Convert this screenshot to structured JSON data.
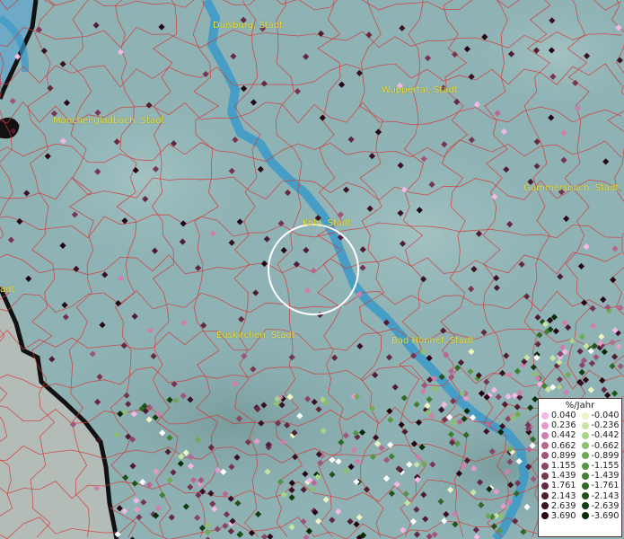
{
  "cities": [
    {
      "id": "duisburg",
      "label": "Duisburg, Stadt"
    },
    {
      "id": "wuppertal",
      "label": "Wuppertal, Stadt"
    },
    {
      "id": "moenchengladbach",
      "label": "Mönchengladbach, Stadt"
    },
    {
      "id": "gummersbach",
      "label": "Gummersbach, Stadt"
    },
    {
      "id": "koeln",
      "label": "Köln, Stadt"
    },
    {
      "id": "euskirchen",
      "label": "Euskirchen, Stadt"
    },
    {
      "id": "bad_honnef",
      "label": "Bad Honnef, Stadt"
    },
    {
      "id": "left_edge",
      "label": "adt"
    }
  ],
  "legend": {
    "title": "%/Jahr",
    "positive": [
      "0.040",
      "0.236",
      "0.442",
      "0.662",
      "0.899",
      "1.155",
      "1.439",
      "1.761",
      "2.143",
      "2.639",
      "3.690"
    ],
    "negative": [
      "-0.040",
      "-0.236",
      "-0.442",
      "-0.662",
      "-0.899",
      "-1.155",
      "-1.439",
      "-1.761",
      "-2.143",
      "-2.639",
      "-3.690"
    ],
    "positive_colors": [
      "#f5b8e6",
      "#e59acc",
      "#cf7fad",
      "#b86890",
      "#a0557a",
      "#8a4465",
      "#763652",
      "#632941",
      "#4f1d31",
      "#3b1222",
      "#260612"
    ],
    "negative_colors": [
      "#eef4c4",
      "#c8e3a4",
      "#a8d488",
      "#8cc06e",
      "#70aa58",
      "#579546",
      "#417e36",
      "#306828",
      "#20521c",
      "#133d11",
      "#072a07"
    ]
  },
  "colors": {
    "land": "#8fb3b5",
    "river": "#2a8fc4",
    "borders": "#cc2a2a",
    "city_label": "#e8e04a",
    "circle": "#ffffff",
    "outside_region": "#b4bcb8"
  }
}
